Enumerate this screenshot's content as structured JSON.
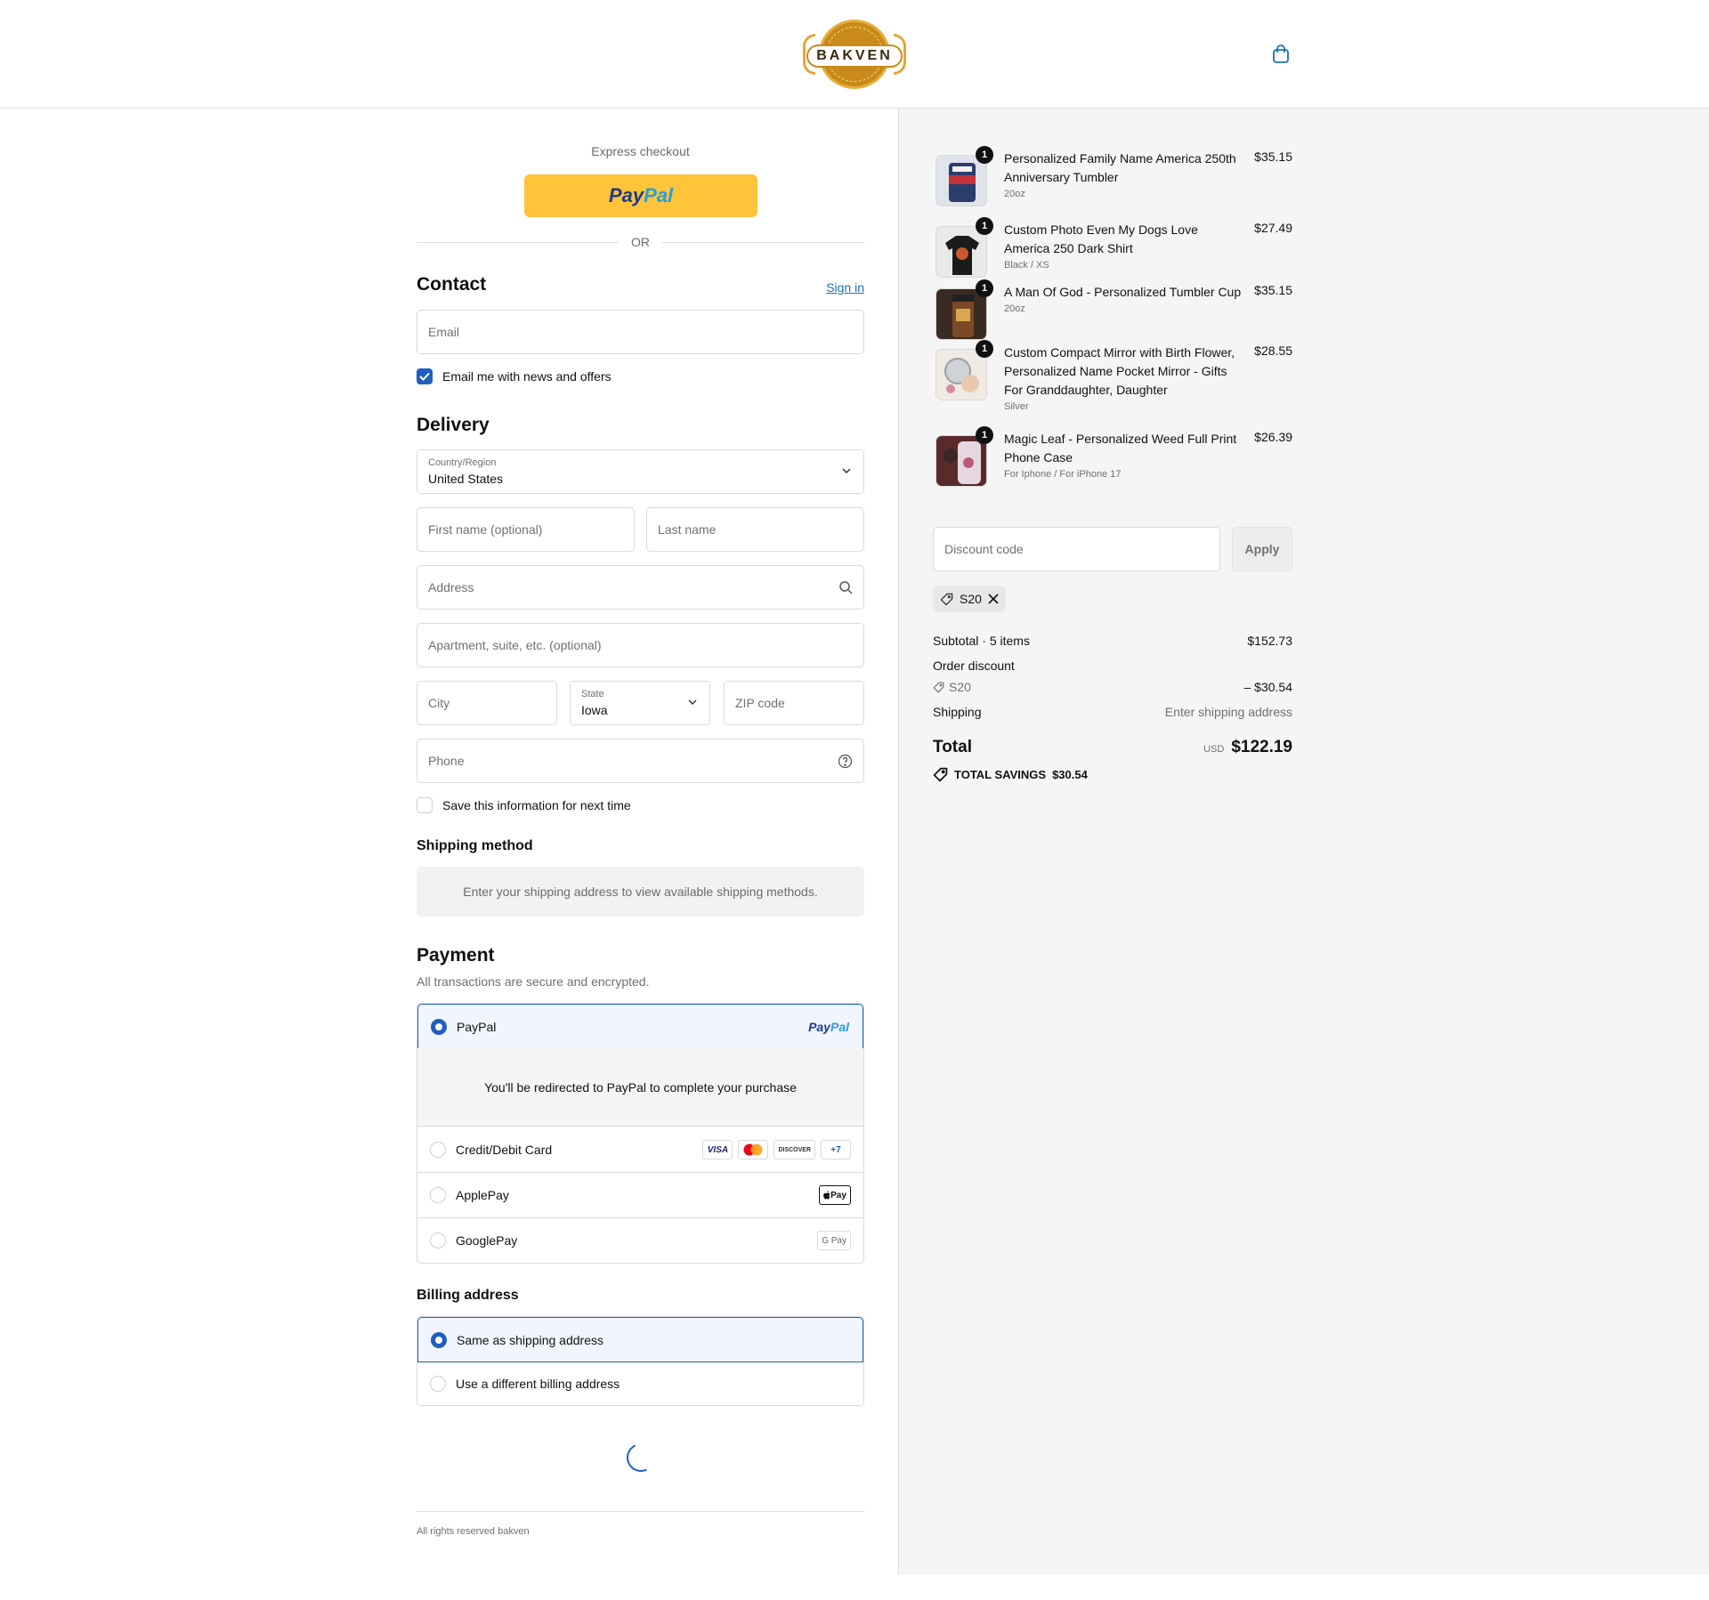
{
  "header": {
    "logo_text": "BAKVEN",
    "cart_icon": "shopping-bag-icon"
  },
  "express": {
    "label": "Express checkout",
    "paypal_a": "Pay",
    "paypal_b": "Pal",
    "or": "OR"
  },
  "contact": {
    "title": "Contact",
    "sign_in": "Sign in",
    "email_placeholder": "Email",
    "newsletter_label": "Email me with news and offers",
    "newsletter_checked": true
  },
  "delivery": {
    "title": "Delivery",
    "country_label": "Country/Region",
    "country_value": "United States",
    "first_name_placeholder": "First name (optional)",
    "last_name_placeholder": "Last name",
    "address_placeholder": "Address",
    "apartment_placeholder": "Apartment, suite, etc. (optional)",
    "city_placeholder": "City",
    "state_label": "State",
    "state_value": "Iowa",
    "zip_placeholder": "ZIP code",
    "phone_placeholder": "Phone",
    "save_info_label": "Save this information for next time"
  },
  "shipping_method": {
    "title": "Shipping method",
    "note": "Enter your shipping address to view available shipping methods."
  },
  "payment": {
    "title": "Payment",
    "subtitle": "All transactions are secure and encrypted.",
    "options": [
      {
        "name": "PayPal",
        "selected": true
      },
      {
        "name": "Credit/Debit Card",
        "selected": false
      },
      {
        "name": "ApplePay",
        "selected": false
      },
      {
        "name": "GooglePay",
        "selected": false
      }
    ],
    "paypal_logo_a": "Pay",
    "paypal_logo_b": "Pal",
    "redirect_note": "You'll be redirected to PayPal to complete your purchase",
    "card_badges": [
      "VISA",
      "",
      "DISCOVER",
      "+7"
    ],
    "applepay_badge": "Pay",
    "googlepay_badge": "G Pay"
  },
  "billing": {
    "title": "Billing address",
    "options": [
      {
        "name": "Same as shipping address",
        "selected": true
      },
      {
        "name": "Use a different billing address",
        "selected": false
      }
    ]
  },
  "footer": {
    "text": "All rights reserved bakven"
  },
  "summary": {
    "items": [
      {
        "qty": "1",
        "title": "Personalized Family Name America 250th Anniversary Tumbler",
        "variant": "20oz",
        "price": "$35.15"
      },
      {
        "qty": "1",
        "title": "Custom Photo Even My Dogs Love America 250 Dark Shirt",
        "variant": "Black / XS",
        "price": "$27.49"
      },
      {
        "qty": "1",
        "title": "A Man Of God - Personalized Tumbler Cup",
        "variant": "20oz",
        "price": "$35.15"
      },
      {
        "qty": "1",
        "title": "Custom Compact Mirror with Birth Flower, Personalized Name Pocket Mirror - Gifts For Granddaughter, Daughter",
        "variant": "Silver",
        "price": "$28.55"
      },
      {
        "qty": "1",
        "title": "Magic Leaf - Personalized Weed Full Print Phone Case",
        "variant": "For Iphone / For iPhone 17",
        "price": "$26.39"
      }
    ],
    "discount_placeholder": "Discount code",
    "apply_label": "Apply",
    "applied_code": "S20",
    "subtotal_label": "Subtotal · 5 items",
    "subtotal_value": "$152.73",
    "order_discount_label": "Order discount",
    "discount_code_label": "S20",
    "discount_value": "– $30.54",
    "shipping_label": "Shipping",
    "shipping_value": "Enter shipping address",
    "total_label": "Total",
    "currency": "USD",
    "total_value": "$122.19",
    "savings_label": "TOTAL SAVINGS",
    "savings_value": "$30.54"
  },
  "colors": {
    "accent": "#1f5fbf",
    "link": "#1773b0",
    "paypal_button": "#ffc43a",
    "summary_bg": "#f5f5f5"
  }
}
